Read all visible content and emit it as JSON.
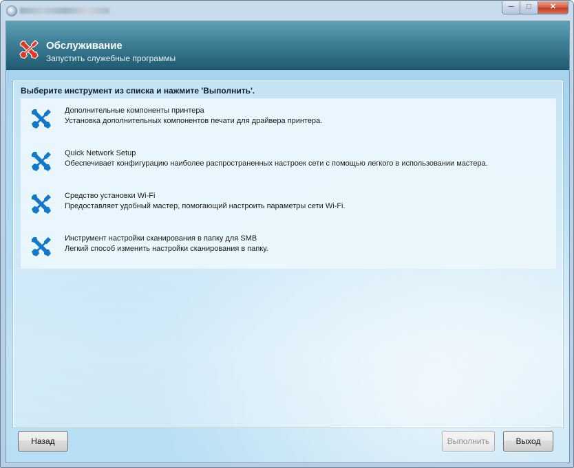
{
  "window": {
    "title": "",
    "minimize_glyph": "─",
    "maximize_glyph": "□",
    "close_glyph": "✕"
  },
  "header": {
    "title": "Обслуживание",
    "subtitle": "Запустить служебные программы",
    "icon": "wrench-screwdriver-icon",
    "icon_color": "#e03a26"
  },
  "panel": {
    "heading": "Выберите инструмент из списка и нажмите 'Выполнить'."
  },
  "tools": [
    {
      "name": "Дополнительные компоненты принтера",
      "description": "Установка дополнительных компонентов печати для драйвера принтера.",
      "icon": "tools-icon"
    },
    {
      "name": "Quick Network Setup",
      "description": "Обеспечивает конфигурацию наиболее распространенных настроек сети с помощью легкого в использовании мастера.",
      "icon": "tools-icon"
    },
    {
      "name": "Средство установки Wi-Fi",
      "description": "Предоставляет удобный мастер, помогающий настроить параметры сети Wi-Fi.",
      "icon": "tools-icon"
    },
    {
      "name": "Инструмент настройки сканирования в папку для SMB",
      "description": "Легкий способ изменить настройки сканирования в папку.",
      "icon": "tools-icon"
    }
  ],
  "tool_icon_color": "#1478c8",
  "buttons": {
    "back": "Назад",
    "run": "Выполнить",
    "run_enabled": false,
    "exit": "Выход"
  }
}
